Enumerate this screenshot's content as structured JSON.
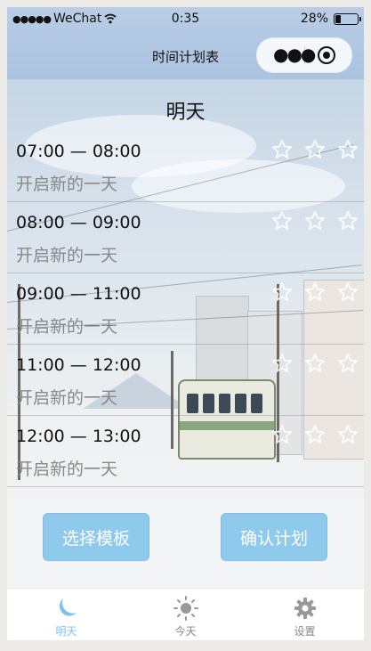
{
  "status_bar": {
    "carrier": "WeChat",
    "time": "0:35",
    "battery_percent": "28%",
    "battery_level": 0.28
  },
  "nav": {
    "title": "时间计划表"
  },
  "day_title": "明天",
  "plans": [
    {
      "range": "07:00 — 08:00",
      "desc": "开启新的一天",
      "stars": 3
    },
    {
      "range": "08:00 — 09:00",
      "desc": "开启新的一天",
      "stars": 3
    },
    {
      "range": "09:00 — 11:00",
      "desc": "开启新的一天",
      "stars": 3
    },
    {
      "range": "11:00 — 12:00",
      "desc": "开启新的一天",
      "stars": 3
    },
    {
      "range": "12:00 — 13:00",
      "desc": "开启新的一天",
      "stars": 3
    }
  ],
  "buttons": {
    "template": "选择模板",
    "confirm": "确认计划"
  },
  "tabs": [
    {
      "label": "明天",
      "icon": "moon-icon",
      "active": true
    },
    {
      "label": "今天",
      "icon": "sun-icon",
      "active": false
    },
    {
      "label": "设置",
      "icon": "gear-icon",
      "active": false
    }
  ],
  "colors": {
    "accent": "#7dc3ea",
    "button": "#8fc9ec",
    "nav_bg": "#b9cde6"
  }
}
